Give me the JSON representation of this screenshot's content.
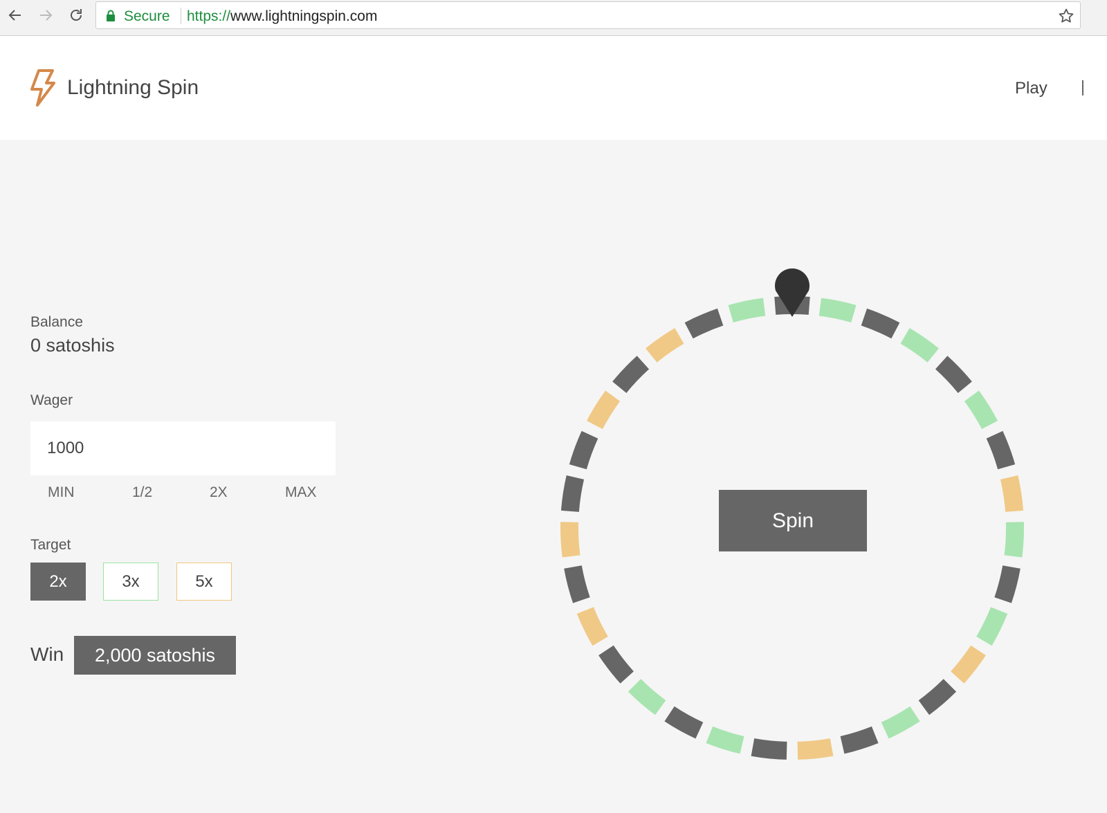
{
  "browser": {
    "secure_label": "Secure",
    "url_scheme": "https://",
    "url_host": "www.lightningspin.com"
  },
  "header": {
    "brand": "Lightning Spin",
    "nav_play": "Play",
    "logo_color": "#d4884a"
  },
  "balance": {
    "label": "Balance",
    "value": "0 satoshis"
  },
  "wager": {
    "label": "Wager",
    "value": "1000",
    "quick_buttons": [
      "MIN",
      "1/2",
      "2X",
      "MAX"
    ]
  },
  "target": {
    "label": "Target",
    "options": [
      "2x",
      "3x",
      "5x"
    ],
    "selected": "2x"
  },
  "win": {
    "label": "Win",
    "value": "2,000 satoshis"
  },
  "wheel": {
    "spin_label": "Spin",
    "colors": {
      "2x": "#666666",
      "3x": "#a8e4b0",
      "5x": "#f0c986"
    },
    "segments": [
      "2x",
      "3x",
      "2x",
      "3x",
      "2x",
      "3x",
      "2x",
      "5x",
      "3x",
      "2x",
      "3x",
      "5x",
      "2x",
      "3x",
      "2x",
      "5x",
      "2x",
      "3x",
      "2x",
      "3x",
      "2x",
      "5x",
      "2x",
      "5x",
      "2x",
      "2x",
      "5x",
      "2x",
      "5x",
      "2x",
      "3x"
    ]
  }
}
